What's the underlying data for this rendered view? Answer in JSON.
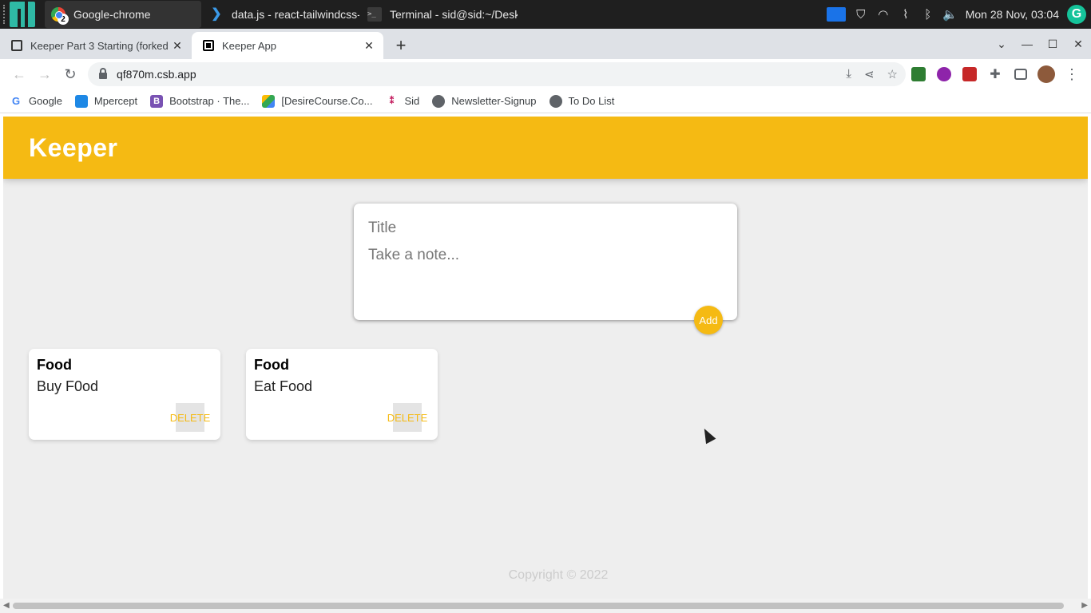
{
  "taskbar": {
    "windows": [
      {
        "label": "Google-chrome",
        "icon": "chrome-icon",
        "badge": "2"
      },
      {
        "label": "data.js - react-tailwindcss-...",
        "icon": "vscode-icon"
      },
      {
        "label": "Terminal - sid@sid:~/Desk...",
        "icon": "terminal-icon"
      }
    ],
    "clock": "Mon 28 Nov, 03:04"
  },
  "browser": {
    "tabs": [
      {
        "title": "Keeper Part 3 Starting (forked",
        "active": false
      },
      {
        "title": "Keeper App",
        "active": true
      }
    ],
    "url": "qf870m.csb.app",
    "bookmarks": [
      {
        "label": "Google",
        "icon": "google-icon"
      },
      {
        "label": "Mpercept",
        "icon": "mpercept-icon"
      },
      {
        "label": "Bootstrap · The...",
        "icon": "bootstrap-icon"
      },
      {
        "label": "[DesireCourse.Co...",
        "icon": "drive-icon"
      },
      {
        "label": "Sid",
        "icon": "sid-icon"
      },
      {
        "label": "Newsletter-Signup",
        "icon": "globe-icon"
      },
      {
        "label": "To Do List",
        "icon": "globe-icon"
      }
    ]
  },
  "app": {
    "title": "Keeper",
    "create": {
      "title_placeholder": "Title",
      "content_placeholder": "Take a note...",
      "add_label": "Add"
    },
    "notes": [
      {
        "title": "Food",
        "content": "Buy F0od",
        "delete_label": "DELETE"
      },
      {
        "title": "Food",
        "content": "Eat Food",
        "delete_label": "DELETE"
      }
    ],
    "footer": "Copyright © 2022"
  },
  "colors": {
    "accent": "#f5ba13",
    "page_bg": "#eeeeee"
  }
}
